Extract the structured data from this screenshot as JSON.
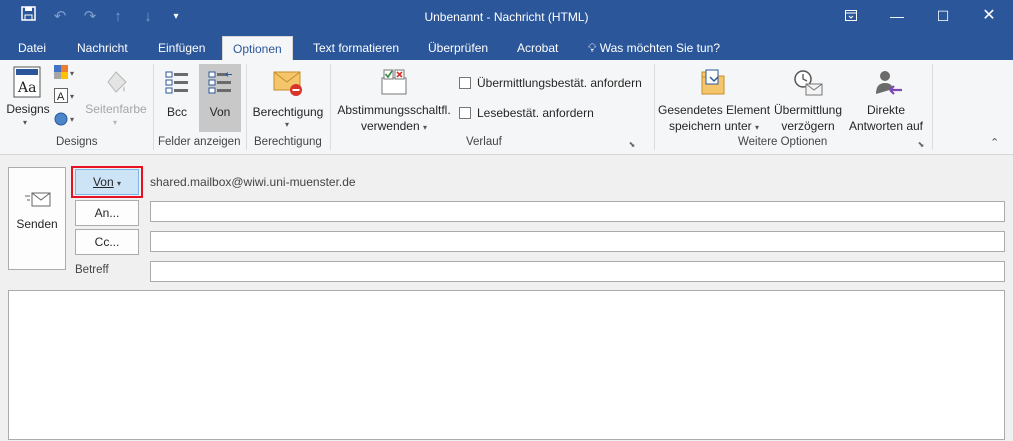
{
  "window": {
    "title": "Unbenannt - Nachricht (HTML)"
  },
  "tabs": [
    "Datei",
    "Nachricht",
    "Einfügen",
    "Optionen",
    "Text formatieren",
    "Überprüfen",
    "Acrobat"
  ],
  "tell_me": "Was möchten Sie tun?",
  "ribbon": {
    "designs_button": "Designs",
    "seitenfarbe": "Seitenfarbe",
    "group_designs": "Designs",
    "bcc": "Bcc",
    "von_toggle": "Von",
    "group_felder": "Felder anzeigen",
    "berechtigung": "Berechtigung",
    "group_berechtigung": "Berechtigung",
    "abstimmung_line1": "Abstimmungsschaltfl.",
    "abstimmung_line2": "verwenden",
    "uebermittlung_chk": "Übermittlungsbestät. anfordern",
    "lese_chk": "Lesebestät. anfordern",
    "group_verlauf": "Verlauf",
    "gesendetes_line1": "Gesendetes Element",
    "gesendetes_line2": "speichern unter",
    "verzoegern_line1": "Übermittlung",
    "verzoegern_line2": "verzögern",
    "direkte_line1": "Direkte",
    "direkte_line2": "Antworten auf",
    "group_weitere": "Weitere Optionen"
  },
  "compose": {
    "send_label": "Senden",
    "von_button": "Von",
    "from_address": "shared.mailbox@wiwi.uni-muenster.de",
    "an_button": "An...",
    "cc_button": "Cc...",
    "betreff_label": "Betreff",
    "to_value": "",
    "cc_value": "",
    "subject_value": "",
    "body_value": ""
  },
  "colors": {
    "accent": "#2b579a",
    "highlight": "#e81123"
  }
}
